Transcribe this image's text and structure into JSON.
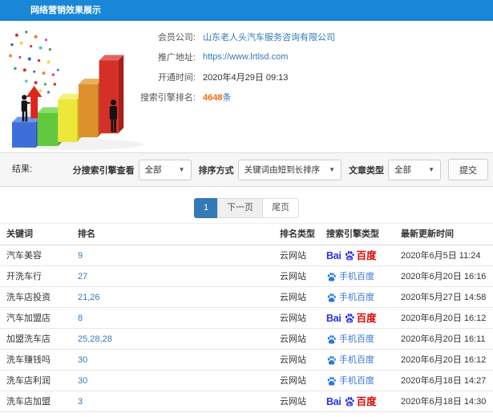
{
  "header": {
    "title": "网络营销效果展示"
  },
  "info": {
    "fields": [
      {
        "label": "会员公司:",
        "value": "山东老人头汽车服务咨询有限公司"
      },
      {
        "label": "推广地址:",
        "value": "https://www.lrtlsd.com"
      },
      {
        "label": "开通时间:",
        "value": "2020年4月29日 09:13"
      },
      {
        "label": "搜索引擎排名:",
        "value": "4648",
        "suffix": "条"
      }
    ]
  },
  "filters": {
    "result_label": "结果:",
    "engine_filter_label": "分搜索引擎查看",
    "engine_filter_value": "全部",
    "sort_label": "排序方式",
    "sort_value": "关键词由短到长排序",
    "article_type_label": "文章类型",
    "article_type_value": "全部",
    "submit_label": "提交"
  },
  "pagination": {
    "current": "1",
    "next": "下一页",
    "last": "尾页"
  },
  "table": {
    "headers": [
      "关键词",
      "排名",
      "排名类型",
      "搜索引擎类型",
      "最新更新时间"
    ],
    "rows": [
      {
        "keyword": "汽车美容",
        "ranking": "9",
        "rank_type": "云网站",
        "engine_type": "pc",
        "updated": "2020年6月5日 11:24"
      },
      {
        "keyword": "开洗车行",
        "ranking": "27",
        "rank_type": "云网站",
        "engine_type": "mobile",
        "updated": "2020年6月20日 16:16"
      },
      {
        "keyword": "洗车店投资",
        "ranking": "21,26",
        "rank_type": "云网站",
        "engine_type": "mobile",
        "updated": "2020年5月27日 14:58"
      },
      {
        "keyword": "汽车加盟店",
        "ranking": "8",
        "rank_type": "云网站",
        "engine_type": "pc",
        "updated": "2020年6月20日 16:12"
      },
      {
        "keyword": "加盟洗车店",
        "ranking": "25,28,28",
        "rank_type": "云网站",
        "engine_type": "mobile",
        "updated": "2020年6月20日 16:11"
      },
      {
        "keyword": "洗车赚钱吗",
        "ranking": "30",
        "rank_type": "云网站",
        "engine_type": "mobile",
        "updated": "2020年6月20日 16:12"
      },
      {
        "keyword": "洗车店利润",
        "ranking": "30",
        "rank_type": "云网站",
        "engine_type": "mobile",
        "updated": "2020年6月18日 14:27"
      },
      {
        "keyword": "洗车店加盟",
        "ranking": "3",
        "rank_type": "云网站",
        "engine_type": "pc",
        "updated": "2020年6月18日 14:30"
      }
    ]
  },
  "logos": {
    "baidu_bai": "Bai",
    "baidu_cn": "百度",
    "mobile_baidu": "手机百度"
  },
  "colors": {
    "header_bar": "#1a86d6",
    "link": "#337ab7",
    "ranking_count": "#ff6600",
    "active_page": "#337ab7",
    "baidu_blue": "#2932e1",
    "baidu_red": "#e10602",
    "mobile_baidu_text": "#3b76d8"
  }
}
